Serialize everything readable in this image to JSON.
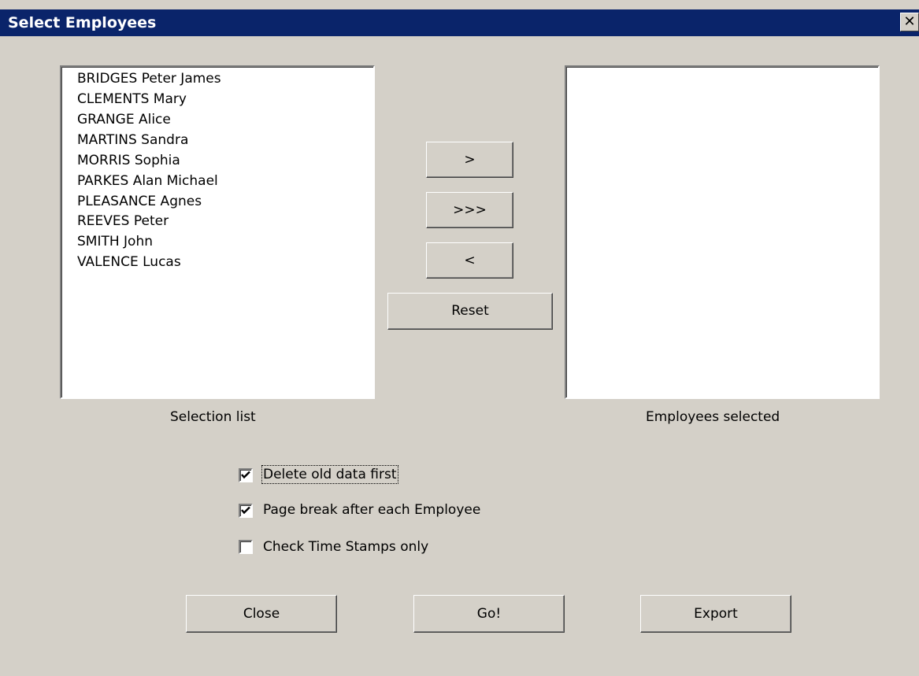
{
  "window": {
    "title": "Select Employees",
    "close_glyph": "✕"
  },
  "selection_list": {
    "items": [
      "BRIDGES Peter James",
      "CLEMENTS Mary",
      "GRANGE Alice",
      "MARTINS Sandra",
      "MORRIS Sophia",
      "PARKES Alan Michael",
      "PLEASANCE Agnes",
      "REEVES Peter",
      "SMITH John",
      "VALENCE Lucas"
    ],
    "caption": "Selection list"
  },
  "selected_list": {
    "items": [],
    "caption": "Employees selected"
  },
  "transfer_buttons": {
    "add_one": ">",
    "add_all": ">>>",
    "remove_one": "<",
    "reset": "Reset"
  },
  "options": {
    "delete_old": {
      "label": "Delete old data first",
      "checked": true
    },
    "page_break": {
      "label": "Page break after each Employee",
      "checked": true
    },
    "time_stamps": {
      "label": "Check Time Stamps only",
      "checked": false
    }
  },
  "footer": {
    "close": "Close",
    "go": "Go!",
    "export": "Export"
  }
}
